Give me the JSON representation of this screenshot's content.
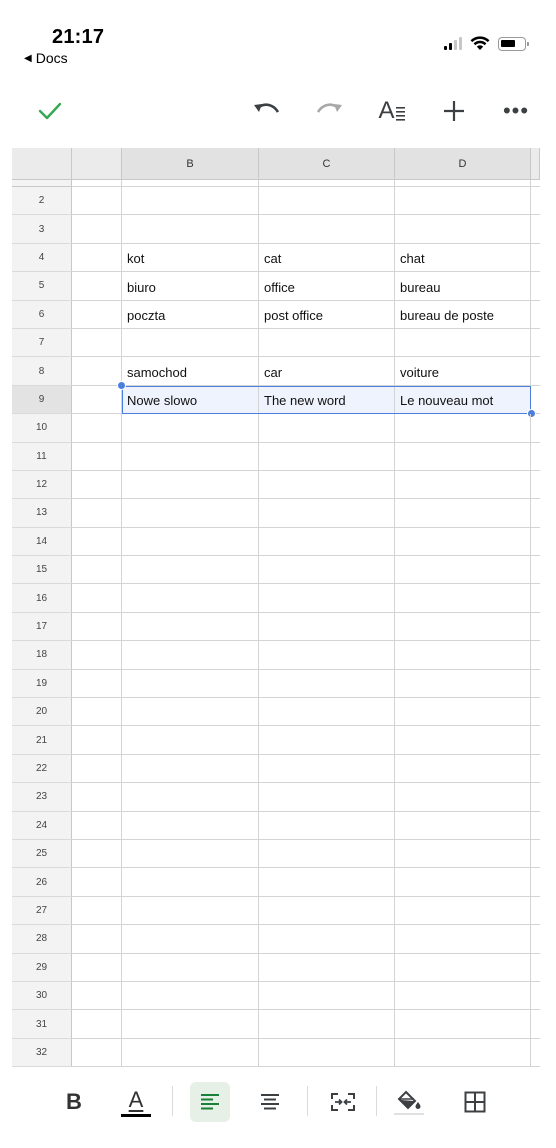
{
  "status": {
    "time": "21:17",
    "back_label": "Docs"
  },
  "toolbar": {
    "icons": [
      "check-icon",
      "undo-icon",
      "redo-icon",
      "text-format-icon",
      "add-icon",
      "more-icon"
    ],
    "text_format_glyph": "A",
    "more_glyph": "•••",
    "accent_color": "#34a853"
  },
  "sheet": {
    "columns": [
      "",
      "B",
      "C",
      "D"
    ],
    "rows": [
      {
        "num": "2",
        "a": "",
        "b": "",
        "c": "",
        "d": ""
      },
      {
        "num": "3",
        "a": "",
        "b": "",
        "c": "",
        "d": ""
      },
      {
        "num": "4",
        "a": "",
        "b": "kot",
        "c": "cat",
        "d": "chat"
      },
      {
        "num": "5",
        "a": "",
        "b": "biuro",
        "c": "office",
        "d": "bureau"
      },
      {
        "num": "6",
        "a": "",
        "b": "poczta",
        "c": "post office",
        "d": "bureau de poste"
      },
      {
        "num": "7",
        "a": "",
        "b": "",
        "c": "",
        "d": ""
      },
      {
        "num": "8",
        "a": "",
        "b": "samochod",
        "c": "car",
        "d": "voiture"
      },
      {
        "num": "9",
        "a": "",
        "b": "Nowe slowo",
        "c": "The new word",
        "d": "Le nouveau mot",
        "selected": true
      },
      {
        "num": "10",
        "a": "",
        "b": "",
        "c": "",
        "d": ""
      },
      {
        "num": "11",
        "a": "",
        "b": "",
        "c": "",
        "d": ""
      },
      {
        "num": "12",
        "a": "",
        "b": "",
        "c": "",
        "d": ""
      },
      {
        "num": "13",
        "a": "",
        "b": "",
        "c": "",
        "d": ""
      },
      {
        "num": "14",
        "a": "",
        "b": "",
        "c": "",
        "d": ""
      },
      {
        "num": "15",
        "a": "",
        "b": "",
        "c": "",
        "d": ""
      },
      {
        "num": "16",
        "a": "",
        "b": "",
        "c": "",
        "d": ""
      },
      {
        "num": "17",
        "a": "",
        "b": "",
        "c": "",
        "d": ""
      },
      {
        "num": "18",
        "a": "",
        "b": "",
        "c": "",
        "d": ""
      },
      {
        "num": "19",
        "a": "",
        "b": "",
        "c": "",
        "d": ""
      },
      {
        "num": "20",
        "a": "",
        "b": "",
        "c": "",
        "d": ""
      },
      {
        "num": "21",
        "a": "",
        "b": "",
        "c": "",
        "d": ""
      },
      {
        "num": "22",
        "a": "",
        "b": "",
        "c": "",
        "d": ""
      },
      {
        "num": "23",
        "a": "",
        "b": "",
        "c": "",
        "d": ""
      },
      {
        "num": "24",
        "a": "",
        "b": "",
        "c": "",
        "d": ""
      },
      {
        "num": "25",
        "a": "",
        "b": "",
        "c": "",
        "d": ""
      },
      {
        "num": "26",
        "a": "",
        "b": "",
        "c": "",
        "d": ""
      },
      {
        "num": "27",
        "a": "",
        "b": "",
        "c": "",
        "d": ""
      },
      {
        "num": "28",
        "a": "",
        "b": "",
        "c": "",
        "d": ""
      },
      {
        "num": "29",
        "a": "",
        "b": "",
        "c": "",
        "d": ""
      },
      {
        "num": "30",
        "a": "",
        "b": "",
        "c": "",
        "d": ""
      },
      {
        "num": "31",
        "a": "",
        "b": "",
        "c": "",
        "d": ""
      },
      {
        "num": "32",
        "a": "",
        "b": "",
        "c": "",
        "d": ""
      }
    ],
    "selection_color": "#4a7fe0"
  },
  "format_bar": {
    "bold_label": "B",
    "text_color_label": "A",
    "icons": [
      "bold-icon",
      "text-color-icon",
      "align-left-icon",
      "align-center-icon",
      "merge-cells-icon",
      "fill-color-icon",
      "borders-icon"
    ],
    "active": "align-left-icon",
    "active_color": "#188038"
  }
}
